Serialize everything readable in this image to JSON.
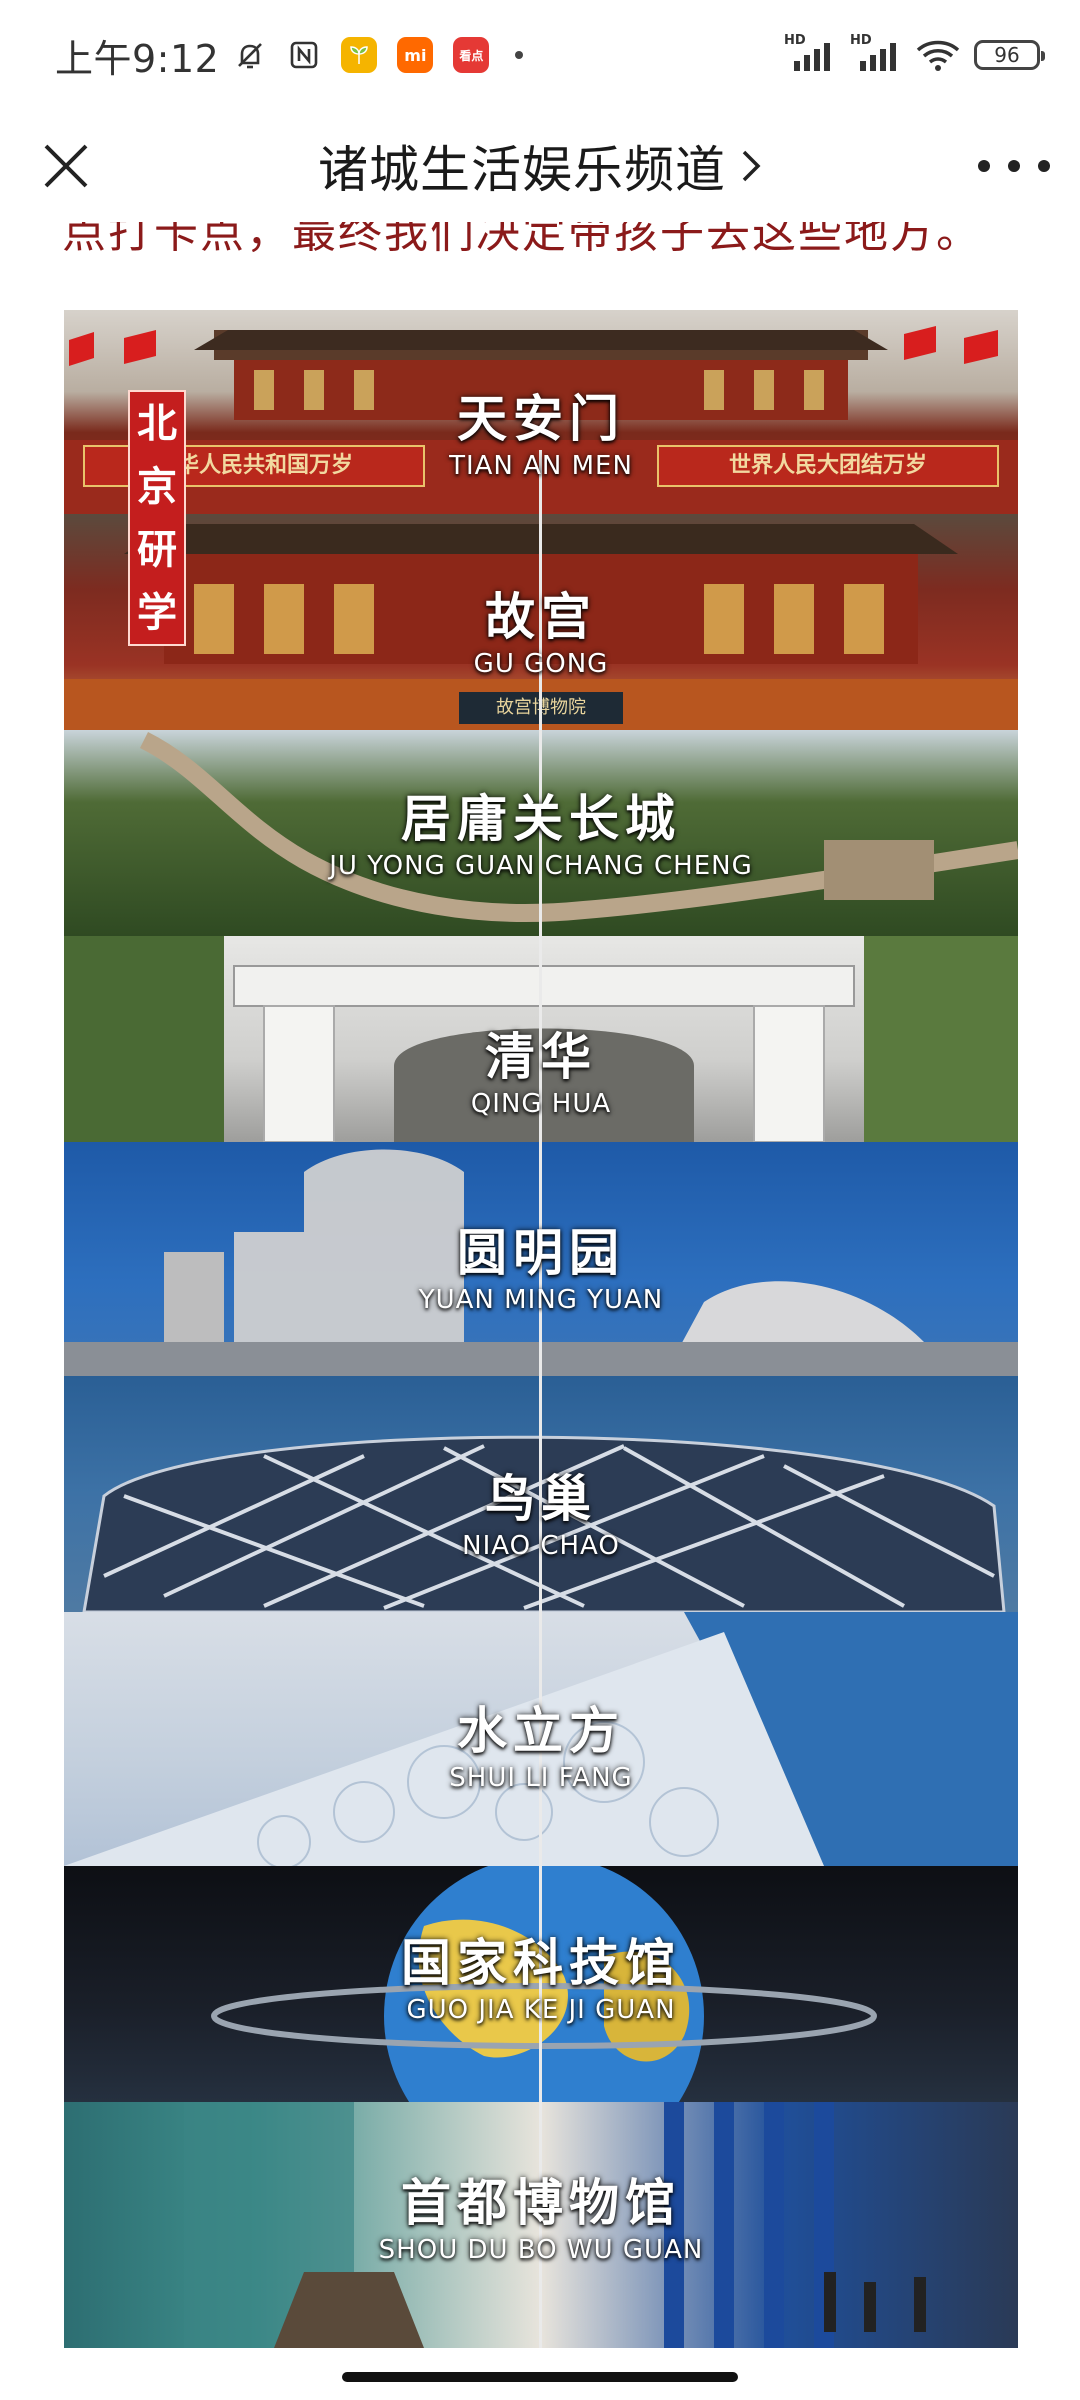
{
  "status_bar": {
    "time": "上午9:12",
    "icons": [
      "mute-bell-icon",
      "nfc-icon",
      "app-notification-icon",
      "mi-app-icon",
      "kandian-app-icon"
    ],
    "app_badges": {
      "mi": "mi",
      "kandian": "看点"
    },
    "signal_labels": [
      "HD",
      "HD"
    ],
    "battery": "96"
  },
  "title_bar": {
    "title": "诸城生活娱乐频道",
    "close_icon": "close-icon",
    "chevron": "chevron-right-icon",
    "more_icon": "more-dots-icon"
  },
  "article": {
    "partial_text": "点打卡点，最终我们决定带孩子去这些地方。"
  },
  "poster": {
    "vertical_tag": [
      "北",
      "京",
      "研",
      "学"
    ],
    "stops": [
      {
        "cn": "天安门",
        "py": "TIAN AN MEN"
      },
      {
        "cn": "故宫",
        "py": "GU GONG"
      },
      {
        "cn": "居庸关长城",
        "py": "JU YONG GUAN CHANG CHENG"
      },
      {
        "cn": "清华",
        "py": "QING HUA"
      },
      {
        "cn": "圆明园",
        "py": "YUAN MING YUAN"
      },
      {
        "cn": "鸟巢",
        "py": "NIAO CHAO"
      },
      {
        "cn": "水立方",
        "py": "SHUI LI FANG"
      },
      {
        "cn": "国家科技馆",
        "py": "GUO JIA KE JI GUAN"
      },
      {
        "cn": "首都博物馆",
        "py": "SHOU DU BO WU GUAN"
      }
    ],
    "banner_left": "中华人民共和国万岁",
    "banner_right": "世界人民大团结万岁",
    "museum_plaque": "故宫博物院"
  }
}
